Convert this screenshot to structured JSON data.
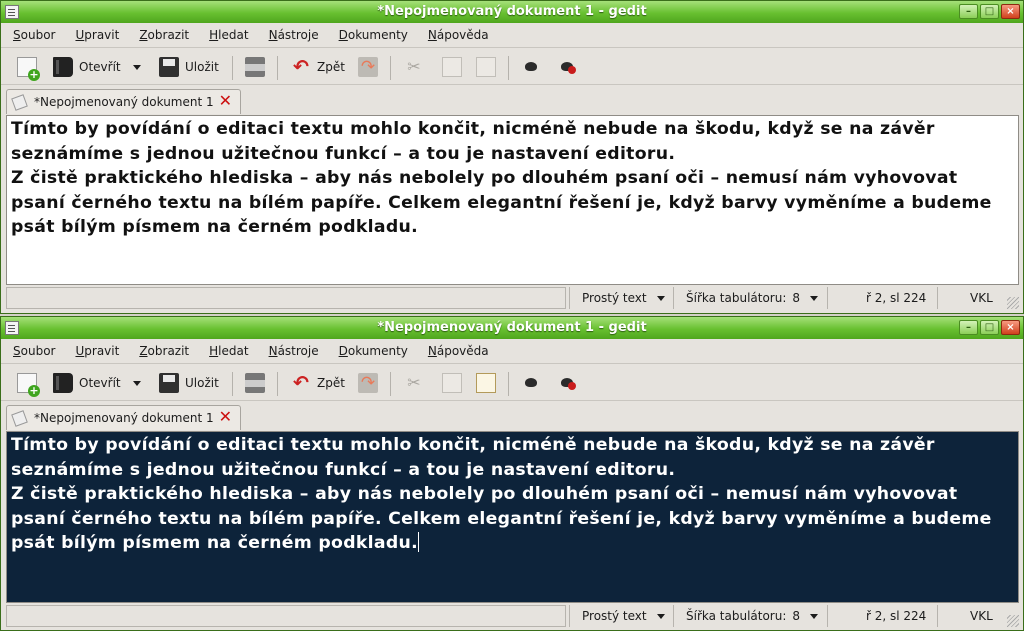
{
  "windows": [
    {
      "title": "*Nepojmenovaný dokument 1 - gedit",
      "menu": [
        "Soubor",
        "Upravit",
        "Zobrazit",
        "Hledat",
        "Nástroje",
        "Dokumenty",
        "Nápověda"
      ],
      "toolbar": {
        "open_label": "Otevřít",
        "save_label": "Uložit",
        "undo_label": "Zpět"
      },
      "tab": {
        "label": "*Nepojmenovaný dokument 1"
      },
      "editor": {
        "text": "Tímto by povídání o editaci textu mohlo končit, nicméně nebude na škodu, když se na závěr\nseznámíme s jednou užitečnou funkcí – a tou je nastavení editoru.\nZ čistě praktického hlediska – aby nás nebolely po dlouhém psaní oči – nemusí nám vyhovovat\npsaní černého textu na bílém papíře. Celkem elegantní řešení je, když barvy vyměníme a budeme\npsát bílým písmem na černém podkladu.",
        "background": "#ffffff",
        "foreground": "#111111"
      },
      "status": {
        "language": "Prostý text",
        "tab_width_label": "Šířka tabulátoru:",
        "tab_width_value": "8",
        "position": "ř 2, sl 224",
        "mode": "VKL"
      }
    },
    {
      "title": "*Nepojmenovaný dokument 1 - gedit",
      "menu": [
        "Soubor",
        "Upravit",
        "Zobrazit",
        "Hledat",
        "Nástroje",
        "Dokumenty",
        "Nápověda"
      ],
      "toolbar": {
        "open_label": "Otevřít",
        "save_label": "Uložit",
        "undo_label": "Zpět"
      },
      "tab": {
        "label": "*Nepojmenovaný dokument 1"
      },
      "editor": {
        "text": "Tímto by povídání o editaci textu mohlo končit, nicméně nebude na škodu, když se na závěr\nseznámíme s jednou užitečnou funkcí – a tou je nastavení editoru.\nZ čistě praktického hlediska – aby nás nebolely po dlouhém psaní oči – nemusí nám vyhovovat\npsaní černého textu na bílém papíře. Celkem elegantní řešení je, když barvy vyměníme a budeme\npsát bílým písmem na černém podkladu.",
        "background": "#0d233a",
        "foreground": "#ffffff"
      },
      "status": {
        "language": "Prostý text",
        "tab_width_label": "Šířka tabulátoru:",
        "tab_width_value": "8",
        "position": "ř 2, sl 224",
        "mode": "VKL"
      }
    }
  ],
  "icons": [
    "new-document-icon",
    "open-icon",
    "save-icon",
    "print-icon",
    "undo-icon",
    "redo-icon",
    "cut-icon",
    "copy-icon",
    "paste-icon",
    "find-icon",
    "find-replace-icon",
    "close-tab-icon"
  ],
  "colors": {
    "titlebar": "#68c030",
    "dark_editor_bg": "#0d233a",
    "tab_close": "#cc1010"
  }
}
